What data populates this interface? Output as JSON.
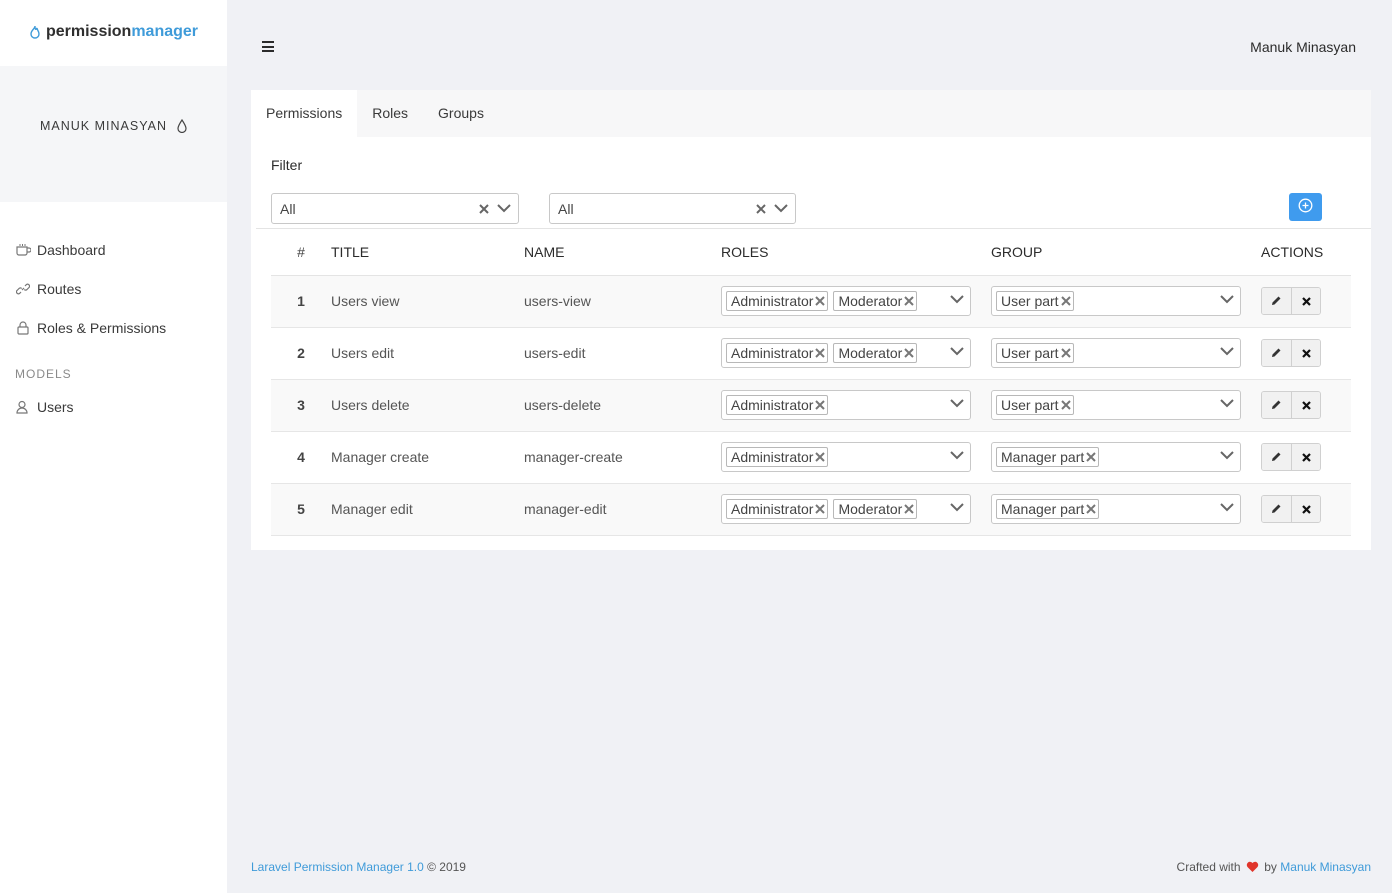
{
  "app": {
    "logo_part1": "permission",
    "logo_part2": "manager"
  },
  "sidebar": {
    "user_name": "MANUK MINASYAN",
    "items": [
      {
        "label": "Dashboard",
        "icon": "coffee-cup-icon"
      },
      {
        "label": "Routes",
        "icon": "link-icon"
      },
      {
        "label": "Roles & Permissions",
        "icon": "lock-icon"
      }
    ],
    "section_label": "MODELS",
    "model_items": [
      {
        "label": "Users",
        "icon": "user-icon"
      }
    ]
  },
  "header": {
    "user_name": "Manuk Minasyan"
  },
  "tabs": [
    {
      "label": "Permissions",
      "active": true
    },
    {
      "label": "Roles",
      "active": false
    },
    {
      "label": "Groups",
      "active": false
    }
  ],
  "filter": {
    "label": "Filter",
    "select1_value": "All",
    "select2_value": "All"
  },
  "table": {
    "headers": {
      "num": "#",
      "title": "TITLE",
      "name": "NAME",
      "roles": "ROLES",
      "group": "GROUP",
      "actions": "ACTIONS"
    },
    "rows": [
      {
        "num": "1",
        "title": "Users view",
        "name": "users-view",
        "roles": [
          "Administrator",
          "Moderator"
        ],
        "group": "User part"
      },
      {
        "num": "2",
        "title": "Users edit",
        "name": "users-edit",
        "roles": [
          "Administrator",
          "Moderator"
        ],
        "group": "User part"
      },
      {
        "num": "3",
        "title": "Users delete",
        "name": "users-delete",
        "roles": [
          "Administrator"
        ],
        "group": "User part"
      },
      {
        "num": "4",
        "title": "Manager create",
        "name": "manager-create",
        "roles": [
          "Administrator"
        ],
        "group": "Manager part"
      },
      {
        "num": "5",
        "title": "Manager edit",
        "name": "manager-edit",
        "roles": [
          "Administrator",
          "Moderator"
        ],
        "group": "Manager part"
      }
    ]
  },
  "footer": {
    "product_link": "Laravel Permission Manager 1.0",
    "copyright": "© 2019",
    "crafted_with": "Crafted with",
    "by": "by",
    "author_link": "Manuk Minasyan"
  },
  "colors": {
    "accent": "#3f9bd9",
    "button_primary": "#3f9bee",
    "heart": "#e0352b"
  }
}
